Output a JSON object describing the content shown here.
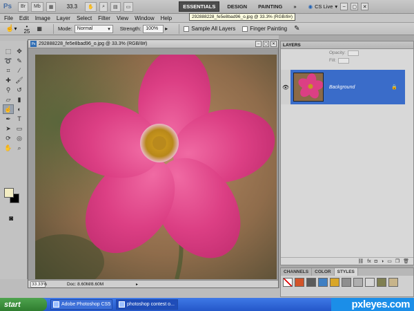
{
  "appbar": {
    "logo": "Ps",
    "btn_br": "Br",
    "btn_mb": "Mb",
    "zoom": "33.3",
    "workspaces": [
      "ESSENTIALS",
      "DESIGN",
      "PAINTING"
    ],
    "more": "»",
    "cslive": "CS Live"
  },
  "menu": [
    "File",
    "Edit",
    "Image",
    "Layer",
    "Select",
    "Filter",
    "View",
    "Window",
    "Help"
  ],
  "options": {
    "brush_size": "25",
    "mode_label": "Mode:",
    "mode_value": "Normal",
    "strength_label": "Strength:",
    "strength_value": "100%",
    "sample_all_layers": "Sample All Layers",
    "finger_painting": "Finger Painting"
  },
  "document": {
    "title": "292888228_fe5e8bad96_o.jpg @ 33.3% (RGB/8#)",
    "tooltip": "292888228_fe5e8bad96_o.jpg @ 33.3% (RGB/8#)",
    "status_zoom": "33.33%",
    "status_doc": "Doc: 8.60M/8.60M"
  },
  "layers": {
    "title": "LAYERS",
    "opacity_label": "Opacity:",
    "fill_label": "Fill:",
    "background_layer": "Background"
  },
  "styles_panel": {
    "tabs": [
      "CHANNELS",
      "COLOR",
      "STYLES"
    ]
  },
  "taskbar": {
    "start": "start",
    "tasks": [
      "Adobe Photoshop CS5",
      "photoshop contest o..."
    ],
    "watermark": "pxleyes.com"
  }
}
